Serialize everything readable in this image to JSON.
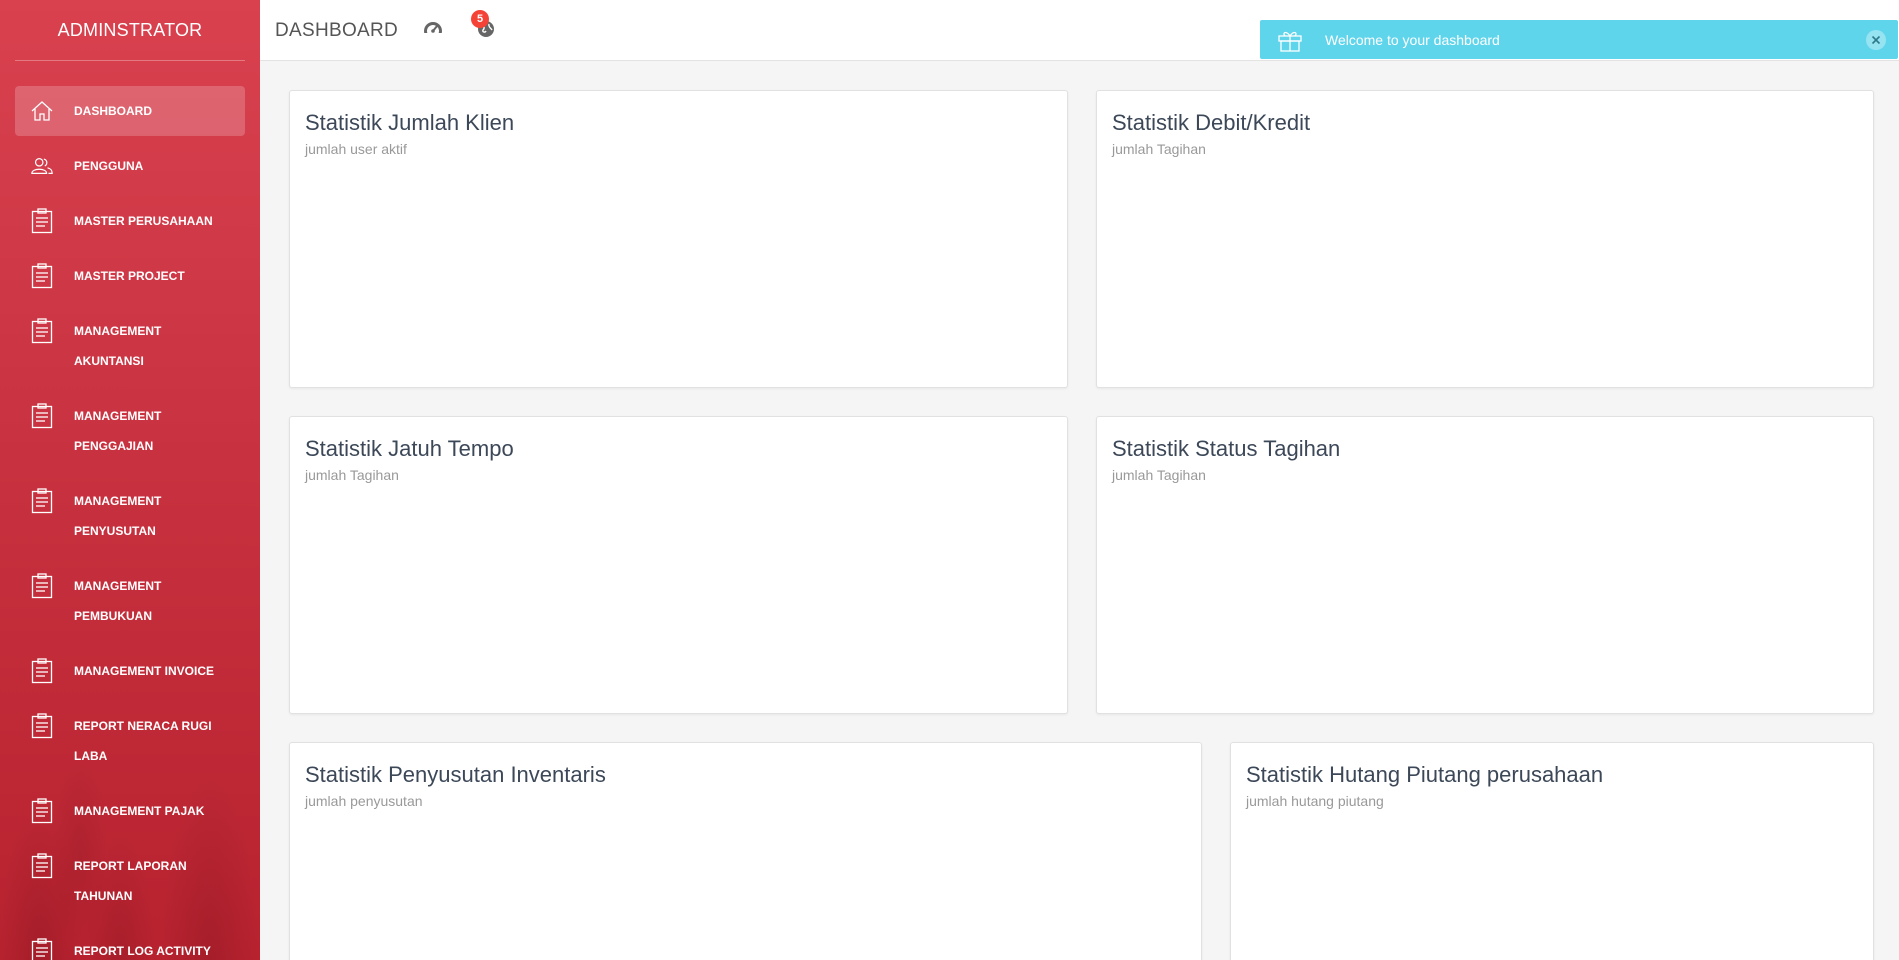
{
  "sidebar": {
    "brand": "ADMINSTRATOR",
    "items": [
      {
        "label": "DASHBOARD",
        "icon": "home-icon",
        "active": true
      },
      {
        "label": "PENGGUNA",
        "icon": "users-icon"
      },
      {
        "label": "MASTER PERUSAHAAN",
        "icon": "clipboard-icon"
      },
      {
        "label": "MASTER PROJECT",
        "icon": "clipboard-icon"
      },
      {
        "label": "MANAGEMENT AKUNTANSI",
        "icon": "clipboard-icon"
      },
      {
        "label": "MANAGEMENT PENGGAJIAN",
        "icon": "clipboard-icon"
      },
      {
        "label": "MANAGEMENT PENYUSUTAN",
        "icon": "clipboard-icon"
      },
      {
        "label": "MANAGEMENT PEMBUKUAN",
        "icon": "clipboard-icon"
      },
      {
        "label": "MANAGEMENT INVOICE",
        "icon": "clipboard-icon"
      },
      {
        "label": "REPORT NERACA RUGI LABA",
        "icon": "clipboard-icon"
      },
      {
        "label": "MANAGEMENT PAJAK",
        "icon": "clipboard-icon"
      },
      {
        "label": "REPORT LAPORAN TAHUNAN",
        "icon": "clipboard-icon"
      },
      {
        "label": "REPORT LOG ACTIVITY",
        "icon": "clipboard-icon"
      }
    ]
  },
  "header": {
    "title": "DASHBOARD",
    "icons": [
      "dashboard-gauge-icon",
      "globe-icon"
    ],
    "notification_count": "5"
  },
  "notification": {
    "message": "Welcome to your dashboard",
    "icon": "gift-icon",
    "color": "#5fd5ec"
  },
  "cards": [
    {
      "title": "Statistik Jumlah Klien",
      "subtitle": "jumlah user aktif"
    },
    {
      "title": "Statistik Debit/Kredit",
      "subtitle": "jumlah Tagihan"
    },
    {
      "title": "Statistik Jatuh Tempo",
      "subtitle": "jumlah Tagihan"
    },
    {
      "title": "Statistik Status Tagihan",
      "subtitle": "jumlah Tagihan"
    },
    {
      "title": "Statistik Penyusutan Inventaris",
      "subtitle": "jumlah penyusutan"
    },
    {
      "title": "Statistik Hutang Piutang perusahaan",
      "subtitle": "jumlah hutang piutang"
    }
  ],
  "colors": {
    "sidebar_accent": "#d9414f",
    "badge": "#f44336"
  }
}
